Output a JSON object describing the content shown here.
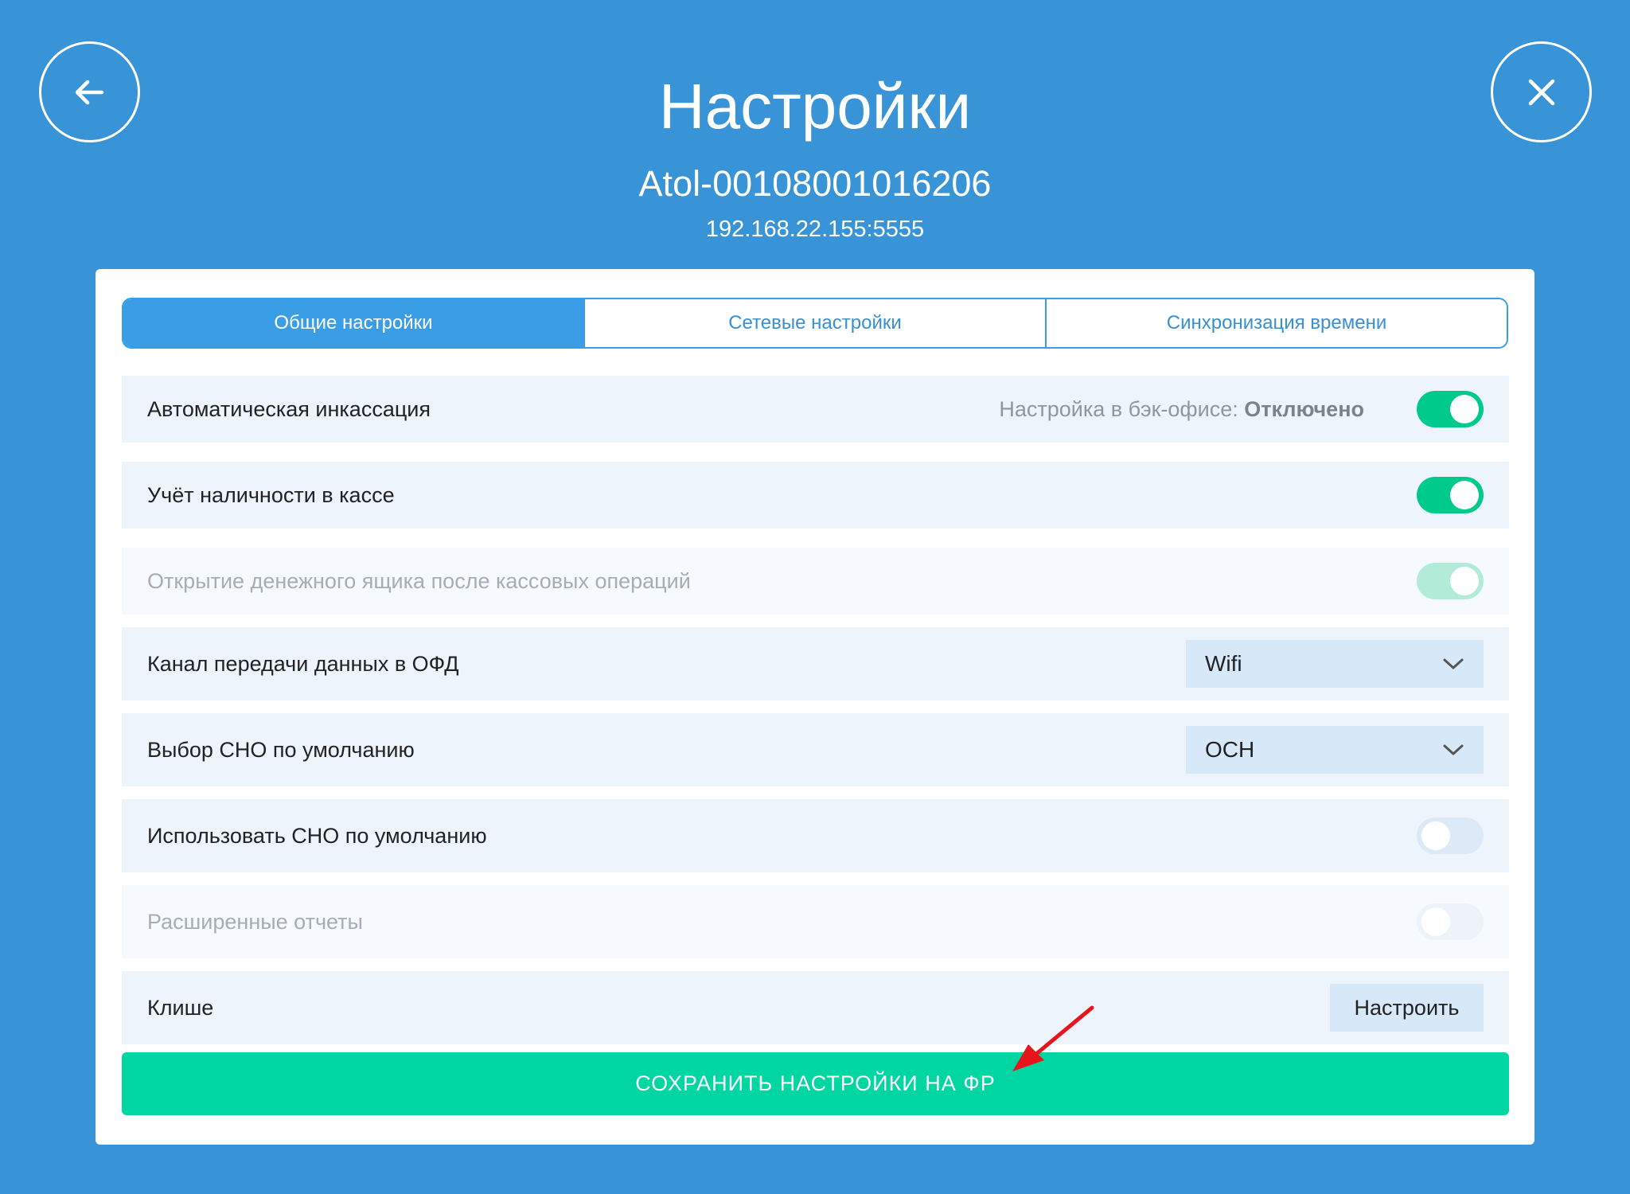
{
  "header": {
    "title": "Настройки",
    "device": "Atol-00108001016206",
    "address": "192.168.22.155:5555"
  },
  "nav": {
    "back_icon": "arrow-left-icon",
    "close_icon": "close-icon"
  },
  "tabs": [
    {
      "label": "Общие настройки",
      "active": true
    },
    {
      "label": "Сетевые настройки",
      "active": false
    },
    {
      "label": "Синхронизация времени",
      "active": false
    }
  ],
  "settings": {
    "auto_collection": {
      "label": "Автоматическая инкассация",
      "note_prefix": "Настройка в бэк-офисе:",
      "note_value": "Отключено",
      "enabled": true
    },
    "cash_accounting": {
      "label": "Учёт наличности в кассе",
      "enabled": true
    },
    "open_drawer": {
      "label": "Открытие денежного ящика после кассовых операций",
      "enabled": true,
      "disabled": true
    },
    "ofd_channel": {
      "label": "Канал передачи данных в ОФД",
      "value": "Wifi"
    },
    "default_tax": {
      "label": "Выбор СНО по умолчанию",
      "value": "ОСН"
    },
    "use_default_tax": {
      "label": "Использовать СНО по умолчанию",
      "enabled": false
    },
    "extended_reports": {
      "label": "Расширенные отчеты",
      "enabled": false,
      "disabled": true
    },
    "cliche": {
      "label": "Клише",
      "button": "Настроить"
    }
  },
  "save_button": "СОХРАНИТЬ НАСТРОЙКИ НА ФР",
  "colors": {
    "background": "#3894d6",
    "accent": "#3a9ee6",
    "toggle_on": "#00c98c",
    "save": "#00d6a2",
    "annotation_arrow": "#e8141c"
  }
}
